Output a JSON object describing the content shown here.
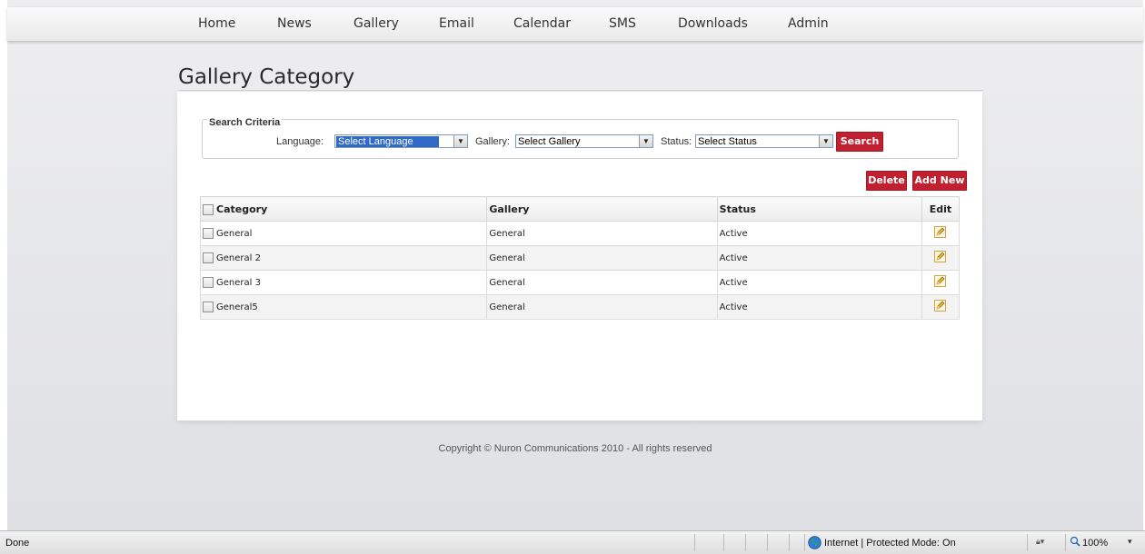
{
  "nav": {
    "items": [
      {
        "label": "Home"
      },
      {
        "label": "News"
      },
      {
        "label": "Gallery"
      },
      {
        "label": "Email"
      },
      {
        "label": "Calendar"
      },
      {
        "label": "SMS"
      },
      {
        "label": "Downloads"
      },
      {
        "label": "Admin"
      }
    ]
  },
  "page": {
    "title": "Gallery Category"
  },
  "search": {
    "legend": "Search Criteria",
    "language_label": "Language:",
    "language_value": "Select Language",
    "gallery_label": "Gallery:",
    "gallery_value": "Select Gallery",
    "status_label": "Status:",
    "status_value": "Select Status",
    "search_button": "Search"
  },
  "actions": {
    "delete_label": "Delete",
    "add_new_label": "Add New"
  },
  "table": {
    "headers": {
      "category": "Category",
      "gallery": "Gallery",
      "status": "Status",
      "edit": "Edit"
    },
    "rows": [
      {
        "category": "General",
        "gallery": "General",
        "status": "Active"
      },
      {
        "category": "General 2",
        "gallery": "General",
        "status": "Active"
      },
      {
        "category": "General 3",
        "gallery": "General",
        "status": "Active"
      },
      {
        "category": "General5",
        "gallery": "General",
        "status": "Active"
      }
    ]
  },
  "footer": {
    "copyright": "Copyright © Nuron Communications 2010 - All rights reserved"
  },
  "statusbar": {
    "status_text": "Done",
    "zone_text": "Internet | Protected Mode: On",
    "zoom_text": "100%"
  },
  "colors": {
    "button_bg": "#c0202f",
    "select_highlight": "#3169c6"
  },
  "icons": {
    "edit": "pencil-icon",
    "zone": "globe-icon",
    "zoom": "magnifier-icon",
    "security": "lock-icon"
  }
}
